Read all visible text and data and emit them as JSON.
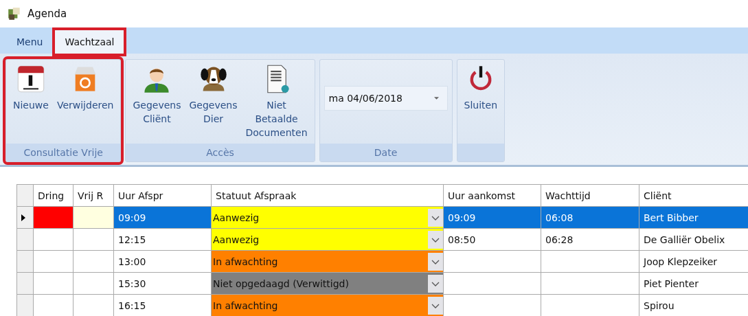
{
  "window": {
    "title": "Agenda"
  },
  "tabs": [
    {
      "label": "Menu",
      "selected": false,
      "highlighted": false
    },
    {
      "label": "Wachtzaal",
      "selected": true,
      "highlighted": true
    }
  ],
  "ribbon_groups": [
    {
      "label": "Consultatie Vrije",
      "highlighted": true,
      "items": [
        {
          "kind": "button",
          "label": "Nieuwe"
        },
        {
          "kind": "button",
          "label": "Verwijderen"
        }
      ]
    },
    {
      "label": "Accès",
      "highlighted": false,
      "items": [
        {
          "kind": "button",
          "label": "Gegevens Cliënt"
        },
        {
          "kind": "button",
          "label": "Gegevens Dier"
        },
        {
          "kind": "button",
          "label": "Niet Betaalde Documenten"
        }
      ]
    },
    {
      "label": "Date",
      "highlighted": false,
      "items": [
        {
          "kind": "dropdown",
          "value": "ma 04/06/2018"
        }
      ]
    },
    {
      "highlighted": false,
      "items": [
        {
          "kind": "button",
          "label": "Sluiten"
        }
      ]
    }
  ],
  "table": {
    "columns": [
      "Dring",
      "Vrij R",
      "Uur Afspr",
      "Statuut Afspraak",
      "Uur aankomst",
      "Wachttijd",
      "Cliënt"
    ],
    "rows": [
      {
        "selected": true,
        "urgent": {
          "color": "#ff0000"
        },
        "free": {
          "color": "#ffffe0"
        },
        "time": "09:09",
        "status": {
          "text": "Aanwezig",
          "color": "#ffff00"
        },
        "arrival": "09:09",
        "wait": "06:08",
        "client": "Bert Bibber"
      },
      {
        "selected": false,
        "time": "12:15",
        "status": {
          "text": "Aanwezig",
          "color": "#ffff00"
        },
        "arrival": "08:50",
        "wait": "06:28",
        "client": "De Galliër Obelix"
      },
      {
        "selected": false,
        "time": "13:00",
        "status": {
          "text": "In afwachting",
          "color": "#ff8000"
        },
        "client": "Joop Klepzeiker"
      },
      {
        "selected": false,
        "time": "15:30",
        "status": {
          "text": "Niet opgedaagd (Verwittigd)",
          "color": "#808080"
        },
        "client": "Piet Pienter"
      },
      {
        "selected": false,
        "time": "16:15",
        "status": {
          "text": "In afwachting",
          "color": "#ff8000"
        },
        "client": " Spirou"
      }
    ]
  }
}
